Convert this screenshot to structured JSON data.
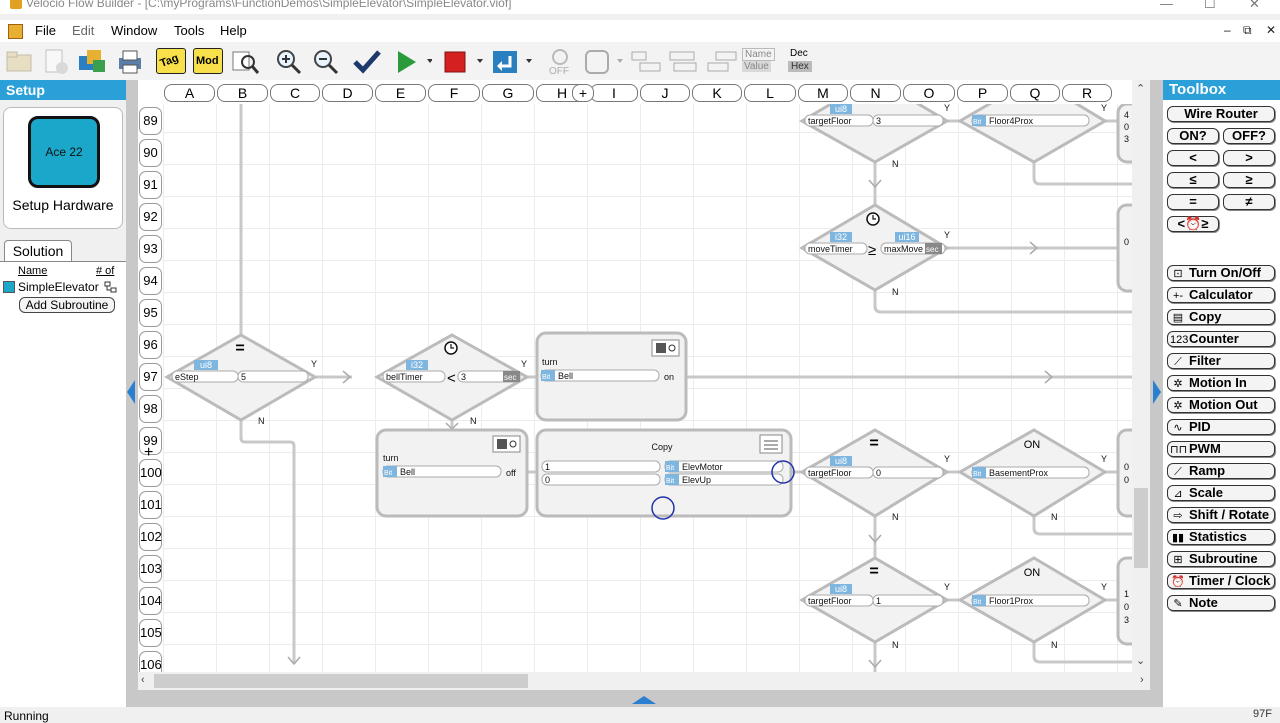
{
  "window": {
    "title": "Velocio Flow Builder - [C:\\myPrograms\\FunctionDemos\\SimpleElevator\\SimpleElevator.viof]",
    "minimize": "—",
    "maximize": "☐",
    "close": "✕"
  },
  "menu": {
    "items": [
      "File",
      "Edit",
      "Window",
      "Tools",
      "Help"
    ],
    "mdi_min": "–",
    "mdi_restore": "⧉",
    "mdi_close": "✕"
  },
  "toolbar": {
    "tag_label": "Tag",
    "mod_label": "Mod",
    "dec_label": "Dec",
    "hex_label": "Hex",
    "name_label": "Name",
    "value_label": "Value",
    "off_label": "OFF"
  },
  "setup": {
    "header": "Setup",
    "device": "Ace 22",
    "button_label": "Setup Hardware"
  },
  "solution": {
    "tab": "Solution",
    "col_name": "Name",
    "col_num": "# of",
    "item": "SimpleElevator",
    "add_button": "Add Subroutine"
  },
  "grid": {
    "columns": [
      "A",
      "B",
      "C",
      "D",
      "E",
      "F",
      "G",
      "H",
      "I",
      "J",
      "K",
      "L",
      "M",
      "N",
      "O",
      "P",
      "Q",
      "R"
    ],
    "rows": [
      "89",
      "90",
      "91",
      "92",
      "93",
      "94",
      "95",
      "96",
      "97",
      "98",
      "99",
      "100",
      "101",
      "102",
      "103",
      "104",
      "105",
      "106"
    ]
  },
  "flow": {
    "d_estep": {
      "op": "=",
      "type": "ui8",
      "left": "eStep",
      "right": "5",
      "yes": "Y",
      "no": "N"
    },
    "d_timer": {
      "op": "<",
      "type": "i32",
      "left": "bellTimer",
      "right": "3",
      "unit": "sec",
      "yes": "Y",
      "no": "N"
    },
    "turn_on": {
      "title": "turn",
      "bit": "Bit",
      "tag": "Bell",
      "state": "on"
    },
    "turn_off": {
      "title": "turn",
      "bit": "Bit",
      "tag": "Bell",
      "state": "off"
    },
    "copy": {
      "title": "Copy",
      "rows": [
        {
          "value": "1",
          "bit": "Bit",
          "tag": "ElevMotor"
        },
        {
          "value": "0",
          "bit": "Bit",
          "tag": "ElevUp"
        }
      ]
    },
    "d_target3": {
      "op": "=",
      "type": "ui8",
      "left": "targetFloor",
      "right": "3",
      "yes": "Y",
      "no": "N"
    },
    "d_floor4": {
      "bit": "Bit",
      "tag": "Floor4Prox",
      "yes": "Y"
    },
    "d_movetimer": {
      "op": "≥",
      "ltype": "i32",
      "rtype": "ui16",
      "left": "moveTimer",
      "right": "maxMove",
      "unit": "sec",
      "yes": "Y",
      "no": "N"
    },
    "d_target0": {
      "op": "=",
      "type": "ui8",
      "left": "targetFloor",
      "right": "0",
      "yes": "Y",
      "no": "N"
    },
    "d_basement": {
      "op": "ON",
      "bit": "Bit",
      "tag": "BasementProx",
      "yes": "Y",
      "no": "N"
    },
    "d_target1": {
      "op": "=",
      "type": "ui8",
      "left": "targetFloor",
      "right": "1",
      "yes": "Y",
      "no": "N"
    },
    "d_floor1": {
      "op": "ON",
      "bit": "Bit",
      "tag": "Floor1Prox",
      "yes": "Y",
      "no": "N"
    },
    "edge_values": [
      "4",
      "0",
      "3",
      "0",
      "0",
      "0",
      "1",
      "0",
      "3"
    ]
  },
  "toolbox": {
    "header": "Toolbox",
    "wire_router": "Wire Router",
    "on_q": "ON?",
    "off_q": "OFF?",
    "lt": "<",
    "gt": ">",
    "le": "≤",
    "ge": "≥",
    "eq": "=",
    "ne": "≠",
    "timer_cmp": "<⏰≥",
    "tools": [
      {
        "label": "Turn On/Off",
        "icon": "⊡"
      },
      {
        "label": "Calculator",
        "icon": "+-"
      },
      {
        "label": "Copy",
        "icon": "▤"
      },
      {
        "label": "Counter",
        "icon": "123"
      },
      {
        "label": "Filter",
        "icon": "⟋"
      },
      {
        "label": "Motion In",
        "icon": "✲"
      },
      {
        "label": "Motion Out",
        "icon": "✲"
      },
      {
        "label": "PID",
        "icon": "∿"
      },
      {
        "label": "PWM",
        "icon": "⊓⊓"
      },
      {
        "label": "Ramp",
        "icon": "⟋"
      },
      {
        "label": "Scale",
        "icon": "⊿"
      },
      {
        "label": "Shift / Rotate",
        "icon": "⇨"
      },
      {
        "label": "Statistics",
        "icon": "▮▮"
      },
      {
        "label": "Subroutine",
        "icon": "⊞"
      },
      {
        "label": "Timer / Clock",
        "icon": "⏰"
      },
      {
        "label": "Note",
        "icon": "✎"
      }
    ]
  },
  "status": {
    "text": "Running",
    "temperature": "97F"
  },
  "colors": {
    "accent": "#2a9fd8",
    "device": "#1aa7c9",
    "tag_bg": "#7fb6e0"
  }
}
